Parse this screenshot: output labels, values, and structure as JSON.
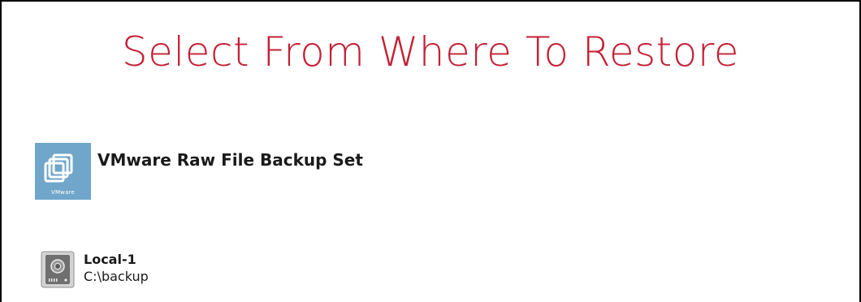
{
  "page": {
    "title": "Select From Where To Restore"
  },
  "backup_set": {
    "name": "VMware Raw File Backup Set",
    "icon": "vmware-icon",
    "icon_caption": "VMware"
  },
  "destination": {
    "name": "Local-1",
    "path": "C:\\backup",
    "icon": "hard-drive-icon"
  },
  "colors": {
    "title": "#c42035",
    "vmware_icon_bg": "#6fa6c9",
    "text": "#1a1a1a"
  }
}
